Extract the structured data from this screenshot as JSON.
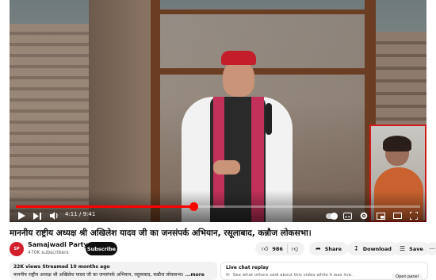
{
  "player": {
    "current_time": "4:11",
    "duration": "9:41",
    "progress_fraction": 0.44,
    "accent_color": "#ff0000",
    "highlight_box_color": "#d11b1b",
    "controls": {
      "play_icon": "play-icon",
      "next_icon": "next-icon",
      "volume_icon": "volume-icon",
      "autoplay_toggle": "autoplay-toggle",
      "captions_icon": "captions-icon",
      "settings_icon": "settings-icon",
      "miniplayer_icon": "miniplayer-icon",
      "theater_icon": "theater-icon",
      "fullscreen_icon": "fullscreen-icon"
    }
  },
  "video": {
    "title": "माननीय राष्ट्रीय अध्यक्ष श्री अखिलेश यादव जी का जनसंपर्क अभियान, रसूलाबाद, कन्नौज लोकसभा।"
  },
  "channel": {
    "name": "Samajwadi Party",
    "verified_icon": "verified-icon",
    "subscribers": "470K subscribers",
    "subscribe_label": "Subscribe",
    "brand_color": "#d21f2b"
  },
  "actions": {
    "like_count": "986",
    "like_icon": "thumbs-up-icon",
    "dislike_icon": "thumbs-down-icon",
    "share_label": "Share",
    "share_icon": "share-icon",
    "download_label": "Download",
    "download_icon": "download-icon",
    "save_label": "Save",
    "save_icon": "save-icon",
    "more_icon": "more-icon"
  },
  "description": {
    "meta": "22K views  Streamed 10 months ago",
    "text": "माननीय राष्ट्रीय अध्यक्ष श्री अखिलेश यादव जी का जनसंपर्क अभियान, रसूलाबाद, कन्नौज लोकसभा। ",
    "more_label": "...more"
  },
  "live_chat": {
    "title": "Live chat replay",
    "text": "See what others said about this video while it was live.",
    "open_panel_label": "Open panel",
    "chat_icon": "chat-icon"
  }
}
